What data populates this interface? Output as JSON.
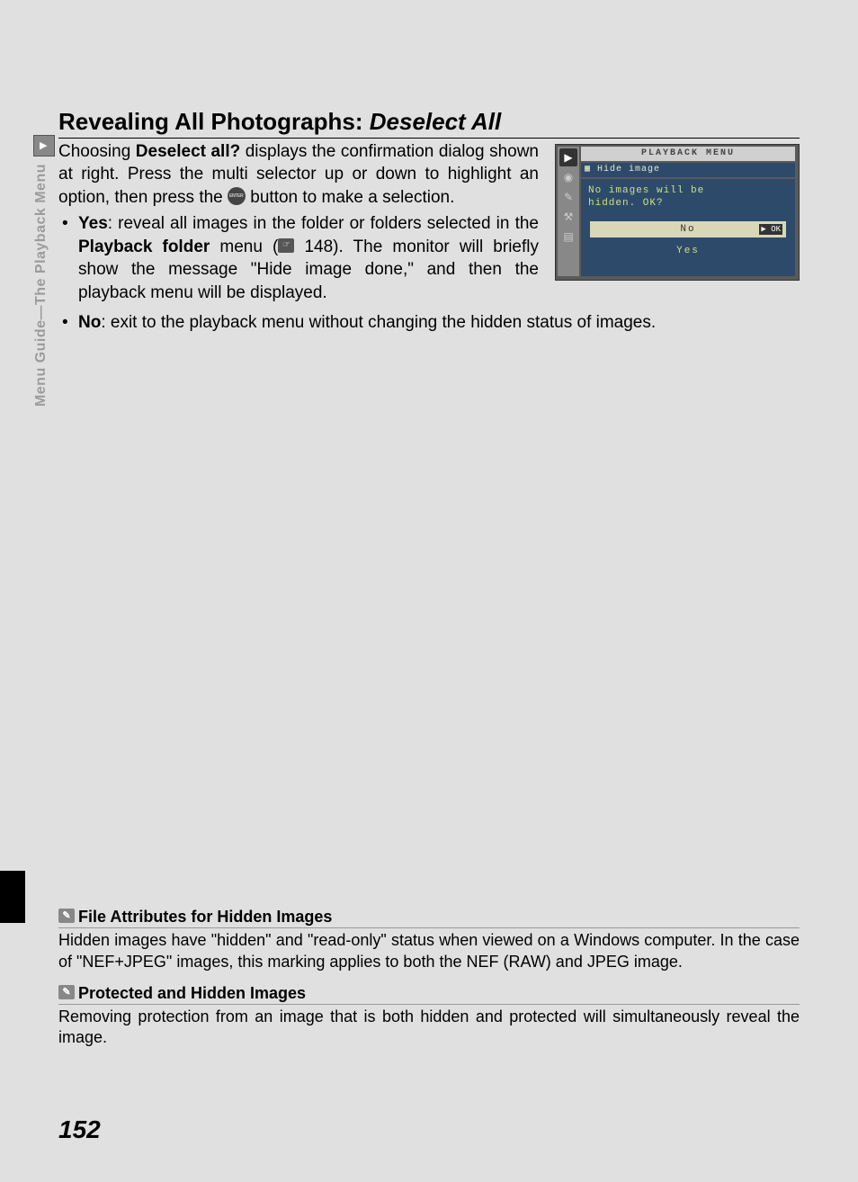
{
  "side": {
    "label": "Menu Guide—The Playback Menu"
  },
  "heading": {
    "prefix": "Revealing All Photographs: ",
    "italic": "Deselect All"
  },
  "intro": {
    "part1": "Choosing ",
    "bold1": "Deselect all?",
    "part2": " displays the confirmation dialog shown at right.  Press the multi selector up or down to highlight an option, then press the ",
    "part3": " button to make a selection."
  },
  "menu_screenshot": {
    "title": "PLAYBACK MENU",
    "subtitle": "Hide image",
    "message1": "No images will be",
    "message2": "hidden. OK?",
    "option_no": "No",
    "option_yes": "Yes"
  },
  "bullets": {
    "yes": {
      "label": "Yes",
      "text1": ": reveal all images in the folder or folders selected in the ",
      "bold": "Playback folder",
      "text2": " menu (",
      "ref": "148",
      "text3": "). The monitor will briefly show the message \"Hide image done,\" and then the playback menu will be displayed."
    },
    "no": {
      "label": "No",
      "text": ": exit to the playback menu without changing the hidden status of images."
    }
  },
  "notes": {
    "n1": {
      "title": "File Attributes for Hidden Images",
      "body": "Hidden images have \"hidden\" and \"read-only\" status when viewed on a Windows computer.  In the case of \"NEF+JPEG\" images, this marking applies to both the NEF (RAW) and JPEG image."
    },
    "n2": {
      "title": "Protected and Hidden Images",
      "body": "Removing protection from an image that is both hidden and protected will simultaneously reveal the image."
    }
  },
  "page_number": "152"
}
